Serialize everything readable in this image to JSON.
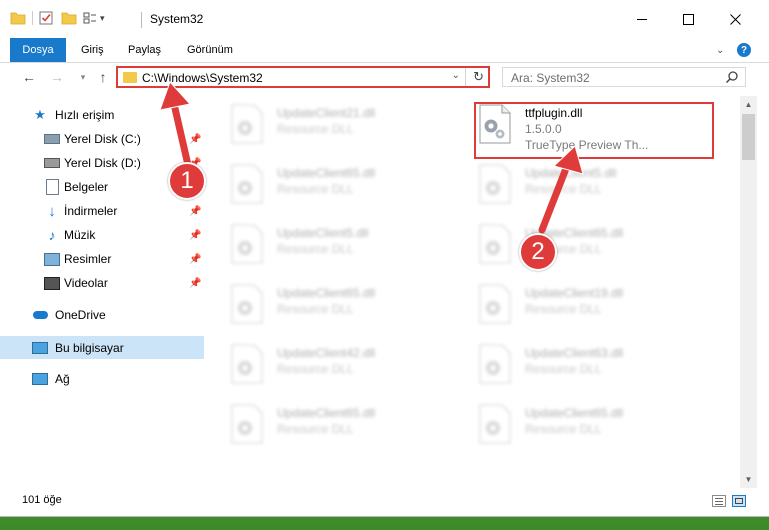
{
  "window": {
    "title": "System32"
  },
  "ribbon": {
    "file_tab": "Dosya",
    "tabs": [
      "Giriş",
      "Paylaş",
      "Görünüm"
    ]
  },
  "address": {
    "path": "C:\\Windows\\System32"
  },
  "search": {
    "placeholder": "Ara: System32"
  },
  "sidebar": {
    "items": [
      {
        "label": "Hızlı erişim",
        "icon": "star-icon"
      },
      {
        "label": "Yerel Disk (C:)",
        "icon": "drive-icon",
        "pinned": true
      },
      {
        "label": "Yerel Disk (D:)",
        "icon": "drive-icon",
        "pinned": true
      },
      {
        "label": "Belgeler",
        "icon": "documents-icon",
        "pinned": true
      },
      {
        "label": "İndirmeler",
        "icon": "download-icon",
        "pinned": true
      },
      {
        "label": "Müzik",
        "icon": "music-icon",
        "pinned": true
      },
      {
        "label": "Resimler",
        "icon": "pictures-icon",
        "pinned": true
      },
      {
        "label": "Videolar",
        "icon": "videos-icon",
        "pinned": true
      },
      {
        "label": "OneDrive",
        "icon": "cloud-icon"
      },
      {
        "label": "Bu bilgisayar",
        "icon": "computer-icon",
        "selected": true
      },
      {
        "label": "Ağ",
        "icon": "network-icon"
      }
    ]
  },
  "files": {
    "left": [
      {
        "name": "UpdateClient21.dll",
        "type": "Resource DLL"
      },
      {
        "name": "UpdateClient65.dll",
        "type": "Resource DLL"
      },
      {
        "name": "UpdateClient5.dll",
        "type": "Resource DLL"
      },
      {
        "name": "UpdateClient65.dll",
        "type": "Resource DLL"
      },
      {
        "name": "UpdateClient42.dll",
        "type": "Resource DLL"
      },
      {
        "name": "UpdateClient65.dll",
        "type": "Resource DLL"
      }
    ],
    "highlighted": {
      "name": "ttfplugin.dll",
      "version": "1.5.0.0",
      "description": "TrueType Preview Th..."
    },
    "right": [
      {
        "name": "UpdateClient5.dll",
        "type": "Resource DLL"
      },
      {
        "name": "UpdateClient65.dll",
        "type": "Resource DLL"
      },
      {
        "name": "UpdateClient19.dll",
        "type": "Resource DLL"
      },
      {
        "name": "UpdateClient63.dll",
        "type": "Resource DLL"
      },
      {
        "name": "UpdateClient65.dll",
        "type": "Resource DLL"
      }
    ]
  },
  "status": {
    "item_count": "101 öğe"
  },
  "annotations": {
    "badge1": "1",
    "badge2": "2"
  },
  "colors": {
    "accent": "#1979ca",
    "highlight_red": "#e03b3b",
    "selected_bg": "#cce4f7"
  }
}
